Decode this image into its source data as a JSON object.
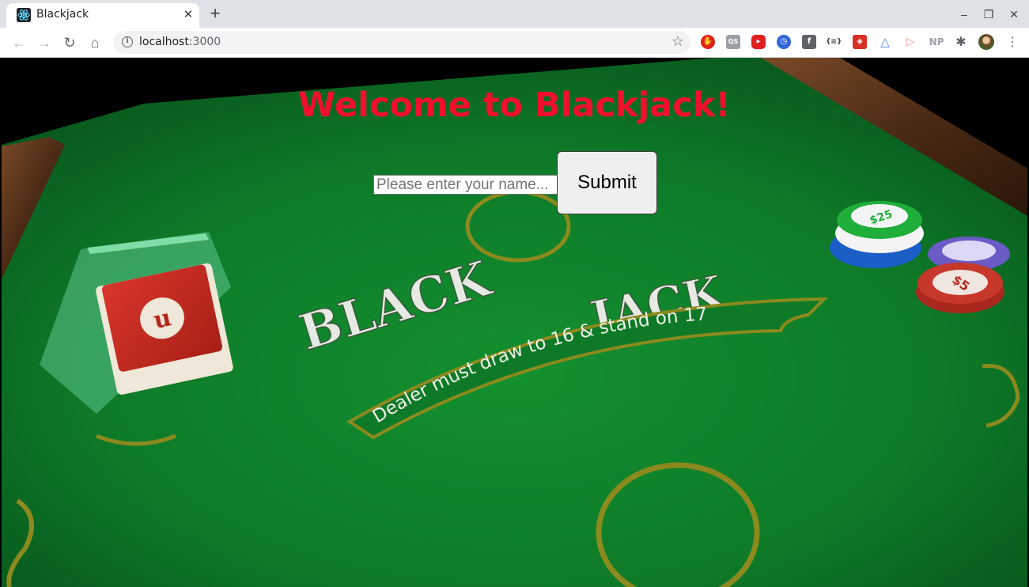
{
  "browser": {
    "tab_title": "Blackjack",
    "tab_close": "✕",
    "new_tab": "+",
    "url_host": "localhost",
    "url_port": ":3000",
    "window_controls": {
      "minimize": "–",
      "restore": "❐",
      "close": "✕"
    },
    "extensions": [
      {
        "name": "adblock-icon",
        "glyph": "✋",
        "color": "#e0221a"
      },
      {
        "name": "qs-extension-icon",
        "glyph": "QS",
        "color": "#9aa0a6"
      },
      {
        "name": "youtube-extension-icon",
        "glyph": "▸",
        "color": "#e01e1e"
      },
      {
        "name": "clock-extension-icon",
        "glyph": "◷",
        "color": "#3367d6"
      },
      {
        "name": "facebook-extension-icon",
        "glyph": "f",
        "color": "#5f6368"
      },
      {
        "name": "json-extension-icon",
        "glyph": "{≡}",
        "color": "#ffffff"
      },
      {
        "name": "puzzle-red-extension-icon",
        "glyph": "◈",
        "color": "#d93025"
      },
      {
        "name": "triangle-extension-icon",
        "glyph": "△",
        "color": "#ffffff"
      },
      {
        "name": "arrow-extension-icon",
        "glyph": "▷",
        "color": "#ffffff"
      },
      {
        "name": "np-extension-icon",
        "glyph": "NP",
        "color": "#ffffff"
      },
      {
        "name": "extensions-puzzle-icon",
        "glyph": "✱",
        "color": "#ffffff"
      }
    ]
  },
  "page": {
    "heading": "Welcome to Blackjack!",
    "name_placeholder": "Please enter your name...",
    "submit_label": "Submit",
    "colors": {
      "heading": "#f0102c",
      "felt": "#0f7a2a"
    }
  },
  "table_art": {
    "logo_line1": "BLACK JACK",
    "banner_text": "Dealer must draw to 16 & stand on 17",
    "chip_label_1": "$25",
    "chip_label_2": "$5"
  }
}
